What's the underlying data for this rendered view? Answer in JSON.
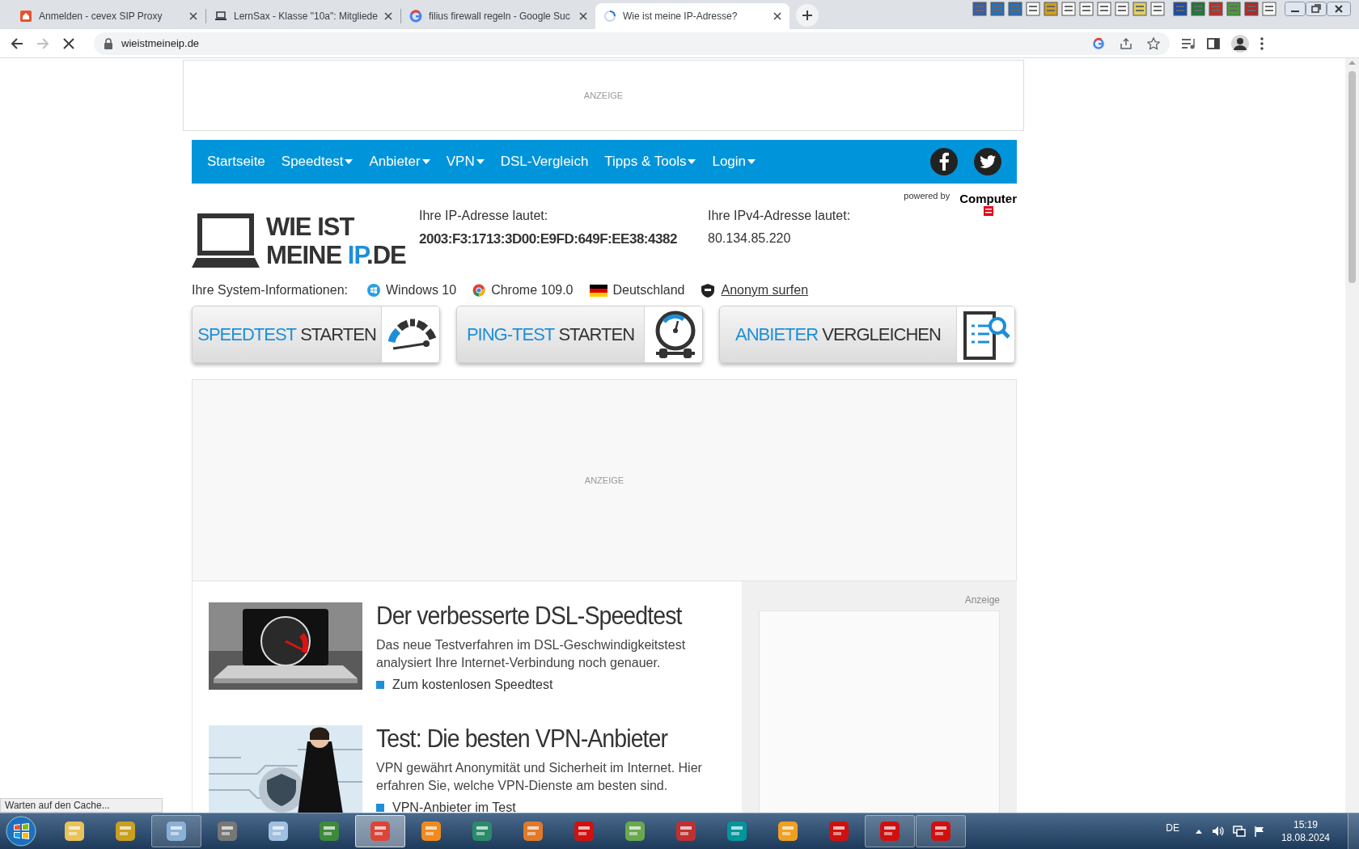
{
  "browser": {
    "tabs": [
      {
        "title": "Anmelden - cevex SIP Proxy",
        "selected": false,
        "kind": "house"
      },
      {
        "title": "LernSax - Klasse \"10a\": Mitgliede",
        "selected": false,
        "kind": "laptop"
      },
      {
        "title": "filius firewall regeln - Google Suc",
        "selected": false,
        "kind": "google"
      },
      {
        "title": "Wie ist meine IP-Adresse?",
        "selected": true,
        "kind": "loading"
      }
    ],
    "url": "wieistmeineip.de",
    "status": "Warten auf den Cache..."
  },
  "page": {
    "ad_top": "ANZEIGE",
    "nav": [
      {
        "label": "Startseite",
        "dropdown": false
      },
      {
        "label": "Speedtest",
        "dropdown": true
      },
      {
        "label": "Anbieter",
        "dropdown": true
      },
      {
        "label": "VPN",
        "dropdown": true
      },
      {
        "label": "DSL-Vergleich",
        "dropdown": false
      },
      {
        "label": "Tipps & Tools",
        "dropdown": true
      },
      {
        "label": "Login",
        "dropdown": true
      }
    ],
    "powered_by": "powered by",
    "brand": "Computer",
    "logo": {
      "line1": "WIE IST",
      "line2": "MEINE ",
      "accent": "IP",
      "suffix": ".DE"
    },
    "ip_label": "Ihre IP-Adresse lautet:",
    "ip_value": "2003:F3:1713:3D00:E9FD:649F:EE38:4382",
    "ipv4_label": "Ihre IPv4-Adresse lautet:",
    "ipv4_value": "80.134.85.220",
    "system_label": "Ihre System-Informationen:",
    "system_items": [
      {
        "text": "Windows 10",
        "kind": "os"
      },
      {
        "text": "Chrome 109.0",
        "kind": "browser"
      },
      {
        "text": "Deutschland",
        "kind": "country"
      },
      {
        "text": "Anonym surfen",
        "kind": "vpn"
      }
    ],
    "buttons": [
      {
        "accent": "SPEEDTEST",
        "rest": "STARTEN",
        "kind": "speedometer"
      },
      {
        "accent": "PING-TEST",
        "rest": "STARTEN",
        "kind": "gauge"
      },
      {
        "accent": "ANBIETER",
        "rest": "VERGLEICHEN",
        "kind": "document"
      }
    ],
    "ad_middle": "ANZEIGE",
    "articles": [
      {
        "title": "Der verbesserte DSL-Speedtest",
        "text": "Das neue Testverfahren im DSL-Geschwindigkeitstest analysiert Ihre Internet-Verbindung noch genauer.",
        "link": "Zum kostenlosen Speedtest",
        "kind": "laptop"
      },
      {
        "title": "Test: Die besten VPN-Anbieter",
        "text": "VPN gewährt Anonymität und Sicherheit im Internet. Hier erfahren Sie, welche VPN-Dienste am besten sind.",
        "link": "VPN-Anbieter im Test",
        "kind": "figure"
      }
    ],
    "sidebar_ad": "Anzeige"
  },
  "taskbar": {
    "apps": [
      {
        "running": false,
        "selected": false
      },
      {
        "running": false,
        "selected": false
      },
      {
        "running": true,
        "selected": false
      },
      {
        "running": false,
        "selected": false
      },
      {
        "running": false,
        "selected": false
      },
      {
        "running": false,
        "selected": false
      },
      {
        "running": true,
        "selected": true
      },
      {
        "running": false,
        "selected": false
      },
      {
        "running": false,
        "selected": false
      },
      {
        "running": false,
        "selected": false
      },
      {
        "running": false,
        "selected": false
      },
      {
        "running": false,
        "selected": false
      },
      {
        "running": false,
        "selected": false
      },
      {
        "running": false,
        "selected": false
      },
      {
        "running": false,
        "selected": false
      },
      {
        "running": false,
        "selected": false
      },
      {
        "running": true,
        "selected": false
      },
      {
        "running": true,
        "selected": false
      }
    ],
    "language": "DE",
    "time": "15:19",
    "date": "18.08.2024"
  }
}
